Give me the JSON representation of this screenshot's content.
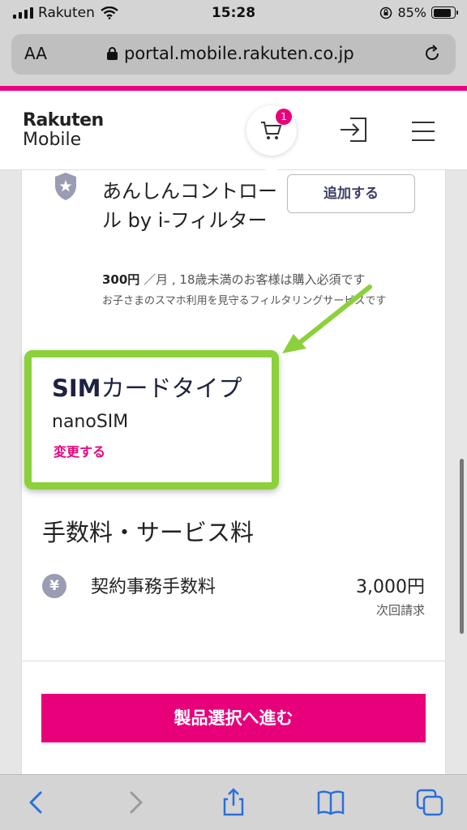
{
  "status_bar": {
    "carrier": "Rakuten",
    "time": "15:28",
    "battery_text": "85%",
    "battery_level": 0.85
  },
  "browser": {
    "text_size_label": "AA",
    "url": "portal.mobile.rakuten.co.jp"
  },
  "header": {
    "logo_line1": "Rakuten",
    "logo_line2": "Mobile",
    "cart_count": "1"
  },
  "option": {
    "name": "あんしんコントロール by i-フィルター",
    "add_label": "追加する",
    "price_amount": "300円",
    "price_note": "／月 , 18歳未満のお客様は購入必須です",
    "description": "お子さまのスマホ利用を見守るフィルタリングサービスです"
  },
  "sim": {
    "title_bold": "SIM",
    "title_rest": "カードタイプ",
    "value": "nanoSIM",
    "change_label": "変更する"
  },
  "fees": {
    "title": "手数料・サービス料",
    "items": [
      {
        "icon": "¥",
        "name": "契約事務手数料",
        "amount": "3,000円",
        "billing": "次回請求"
      }
    ]
  },
  "proceed_label": "製品選択へ進む",
  "colors": {
    "brand_pink": "#e8007b",
    "highlight_green": "#8cd13c",
    "navy": "#1e2140"
  }
}
